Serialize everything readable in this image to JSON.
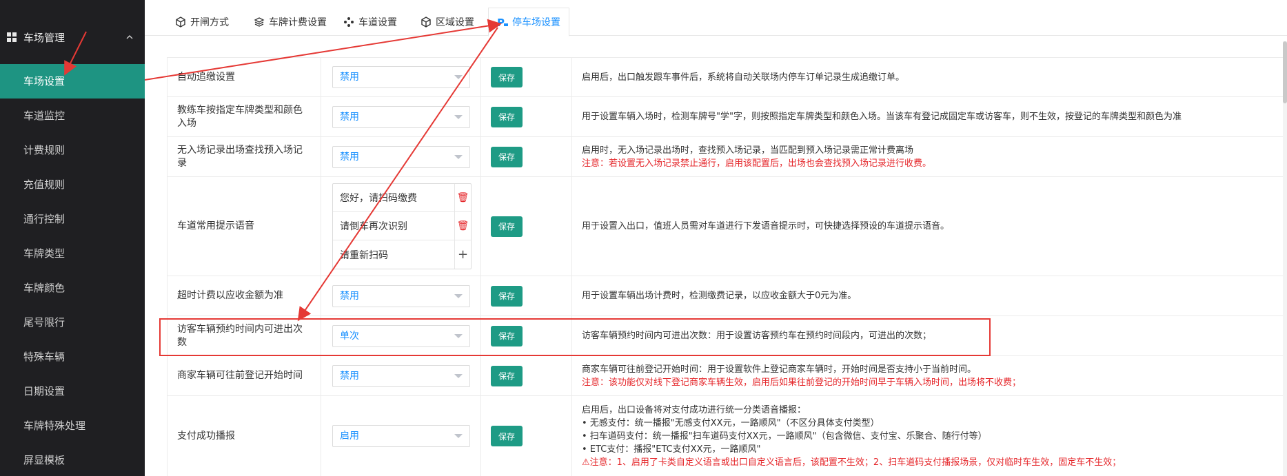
{
  "sidebar": {
    "group_label": "车场管理",
    "items": [
      {
        "label": "车场设置",
        "active": true
      },
      {
        "label": "车道监控"
      },
      {
        "label": "计费规则"
      },
      {
        "label": "充值规则"
      },
      {
        "label": "通行控制"
      },
      {
        "label": "车牌类型"
      },
      {
        "label": "车牌颜色"
      },
      {
        "label": "尾号限行"
      },
      {
        "label": "特殊车辆"
      },
      {
        "label": "日期设置"
      },
      {
        "label": "车牌特殊处理"
      },
      {
        "label": "屏显模板"
      }
    ]
  },
  "tabs": [
    {
      "label": "开闸方式",
      "icon": "cube-icon"
    },
    {
      "label": "车牌计费设置",
      "icon": "layers-icon"
    },
    {
      "label": "车道设置",
      "icon": "lane-icon"
    },
    {
      "label": "区域设置",
      "icon": "cube-icon"
    },
    {
      "label": "停车场设置",
      "icon": "parking-icon",
      "active": true
    }
  ],
  "save_label": "保存",
  "rows": [
    {
      "name": "自动追缴设置",
      "value": "禁用",
      "desc": [
        "启用后，出口触发跟车事件后，系统将自动关联场内停车订单记录生成追缴订单。"
      ]
    },
    {
      "name": "教练车按指定车牌类型和颜色入场",
      "value": "禁用",
      "desc": [
        "用于设置车辆入场时，检测车牌号\"学\"字，则按照指定车牌类型和颜色入场。当该车有登记成固定车或访客车，则不生效，按登记的车牌类型和颜色为准"
      ]
    },
    {
      "name": "无入场记录出场查找预入场记录",
      "value": "禁用",
      "desc": [
        "启用时，无入场记录出场时，查找预入场记录，当匹配到预入场记录需正常计费离场"
      ],
      "warn": [
        "注意：若设置无入场记录禁止通行，启用该配置后，出场也会查找预入场记录进行收费。"
      ]
    },
    {
      "name": "车道常用提示语音",
      "voices": [
        "您好，请扫码缴费",
        "请倒车再次识别",
        "请重新扫码"
      ],
      "desc": [
        "用于设置入出口，值班人员需对车道进行下发语音提示时，可快捷选择预设的车道提示语音。"
      ]
    },
    {
      "name": "超时计费以应收金额为准",
      "value": "禁用",
      "desc": [
        "用于设置车辆出场计费时，检测缴费记录，以应收金额大于0元为准。"
      ]
    },
    {
      "name": "访客车辆预约时间内可进出次数",
      "value": "单次",
      "desc": [
        "访客车辆预约时间内可进出次数：用于设置访客预约车在预约时间段内，可进出的次数；"
      ]
    },
    {
      "name": "商家车辆可往前登记开始时间",
      "value": "禁用",
      "desc": [
        "商家车辆可往前登记开始时间：用于设置软件上登记商家车辆时，开始时间是否支持小于当前时间。"
      ],
      "warn": [
        "注意：该功能仅对线下登记商家车辆生效，启用后如果往前登记的开始时间早于车辆入场时间，出场将不收费；"
      ]
    },
    {
      "name": "支付成功播报",
      "value": "启用",
      "desc": [
        "启用后，出口设备将对支付成功进行统一分类语音播报：",
        "• 无感支付：统一播报\"无感支付XX元，一路顺风\"（不区分具体支付类型）",
        "• 扫车道码支付：统一播报\"扫车道码支付XX元，一路顺风\"（包含微信、支付宝、乐聚合、随行付等）",
        "• ETC支付：播报\"ETC支付XX元，一路顺风\""
      ],
      "warn": [
        "注意：1、启用了卡类自定义语言或出口自定义语言后，该配置不生效；2、扫车道码支付播报场景，仅对临时车生效，固定车不生效；"
      ]
    }
  ],
  "colors": {
    "sidebar_bg": "#1f1f22",
    "active_item": "#1e9482",
    "save_btn": "#1e9b85",
    "link_blue": "#1890ff",
    "warning": "#e5262a",
    "annotation": "#e53935"
  }
}
